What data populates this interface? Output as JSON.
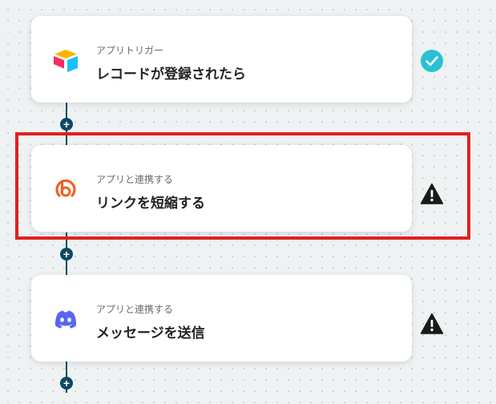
{
  "flow": {
    "steps": [
      {
        "subtitle": "アプリトリガー",
        "title": "レコードが登録されたら",
        "app_icon": "airtable-icon",
        "status": "success",
        "status_icon": "check-circle-icon"
      },
      {
        "subtitle": "アプリと連携する",
        "title": "リンクを短縮する",
        "app_icon": "bitly-icon",
        "status": "warning",
        "status_icon": "warning-triangle-icon"
      },
      {
        "subtitle": "アプリと連携する",
        "title": "メッセージを送信",
        "app_icon": "discord-icon",
        "status": "warning",
        "status_icon": "warning-triangle-icon"
      }
    ],
    "add_button_symbol": "+"
  },
  "colors": {
    "connector": "#0b4a63",
    "success": "#29c1d6",
    "warning": "#1a1a1a",
    "highlight": "#e02020",
    "airtable_yellow": "#fcb400",
    "airtable_red": "#f82b60",
    "airtable_blue": "#18bfff",
    "bitly": "#ee6123",
    "discord": "#5865f2"
  }
}
